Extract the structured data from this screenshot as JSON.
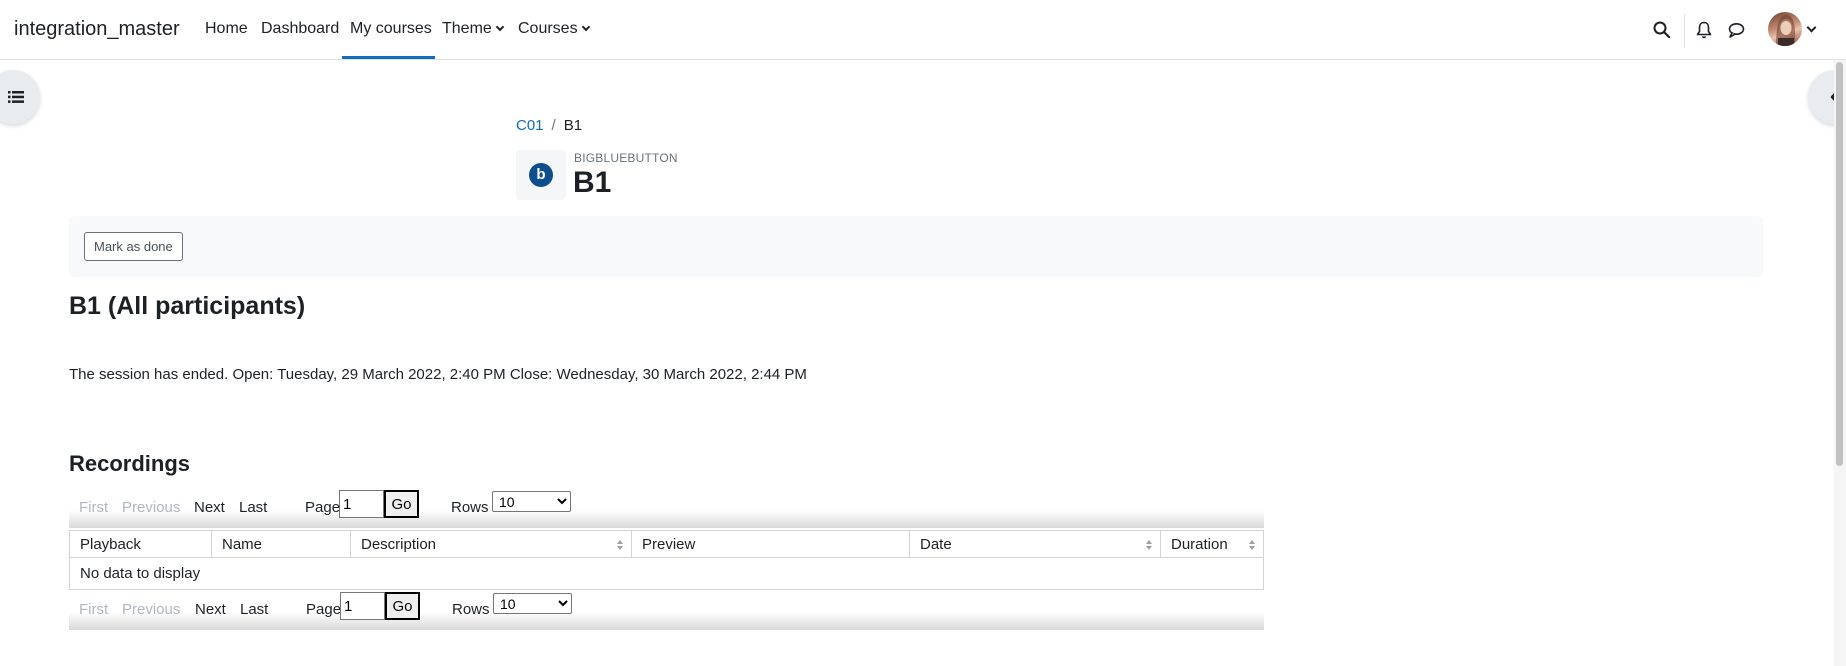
{
  "navbar": {
    "brand": "integration_master",
    "items": [
      {
        "label": "Home"
      },
      {
        "label": "Dashboard"
      },
      {
        "label": "My courses"
      },
      {
        "label": "Theme"
      },
      {
        "label": "Courses"
      }
    ],
    "active_item": "My courses"
  },
  "header": {
    "breadcrumb": [
      {
        "label": "C01"
      },
      {
        "label": "B1"
      }
    ],
    "module_type": "BIGBLUEBUTTON",
    "module_icon_letter": "b",
    "title": "B1"
  },
  "activity": {
    "mark_done_label": "Mark as done"
  },
  "session": {
    "title": "B1 (All participants)",
    "status": "The session has ended. Open: Tuesday, 29 March 2022, 2:40 PM Close: Wednesday, 30 March 2022, 2:44 PM"
  },
  "recordings": {
    "title": "Recordings",
    "pager": {
      "first": "First",
      "previous": "Previous",
      "next": "Next",
      "last": "Last",
      "page_label": "Page",
      "page_value": "1",
      "go_label": "Go",
      "rows_label": "Rows",
      "rows_value": "10"
    },
    "columns": [
      "Playback",
      "Name",
      "Description",
      "Preview",
      "Date",
      "Duration"
    ],
    "empty_message": "No data to display"
  },
  "colors": {
    "accent": "#0f6cbf",
    "module_icon": "#0f4e8c"
  },
  "icons": [
    "search-icon",
    "bell-icon",
    "chat-icon",
    "index-drawer-icon",
    "chevron-left-icon"
  ]
}
